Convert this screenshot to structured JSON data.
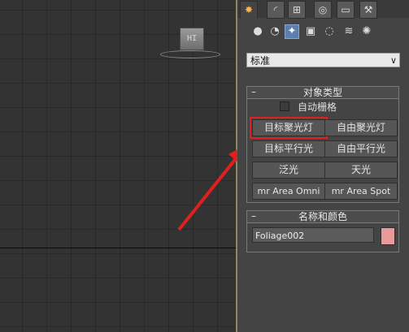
{
  "viewport": {
    "light_label": "HI"
  },
  "panel": {
    "tabs": [
      {
        "icon": "create-star-icon",
        "glyph": "✸"
      },
      {
        "icon": "modify-arc-icon",
        "glyph": "◜"
      },
      {
        "icon": "hierarchy-icon",
        "glyph": "⊞"
      },
      {
        "icon": "motion-icon",
        "glyph": "◎"
      },
      {
        "icon": "display-monitor-icon",
        "glyph": "▭"
      },
      {
        "icon": "utilities-hammer-icon",
        "glyph": "⚒"
      }
    ],
    "subcategories": [
      {
        "icon": "geometry-sphere-icon",
        "glyph": "●"
      },
      {
        "icon": "shapes-icon",
        "glyph": "◔"
      },
      {
        "icon": "lights-icon",
        "glyph": "✦"
      },
      {
        "icon": "cameras-icon",
        "glyph": "▣"
      },
      {
        "icon": "helpers-icon",
        "glyph": "◌"
      },
      {
        "icon": "space-warps-icon",
        "glyph": "≋"
      },
      {
        "icon": "systems-icon",
        "glyph": "✺"
      }
    ],
    "dropdown_value": "标准",
    "object_type": {
      "title": "对象类型",
      "collapse": "–",
      "autogrid_label": "自动栅格",
      "buttons": {
        "target_spot": "目标聚光灯",
        "free_spot": "自由聚光灯",
        "target_direct": "目标平行光",
        "free_direct": "自由平行光",
        "omni": "泛光",
        "skylight": "天光",
        "mr_omni": "mr Area Omni",
        "mr_spot": "mr Area Spot"
      }
    },
    "name_color": {
      "title": "名称和颜色",
      "collapse": "–",
      "name_value": "Foliage002",
      "swatch_color": "#e69a9a"
    }
  },
  "colors": {
    "highlight": "#e0201f",
    "arrow": "#e0201f"
  }
}
